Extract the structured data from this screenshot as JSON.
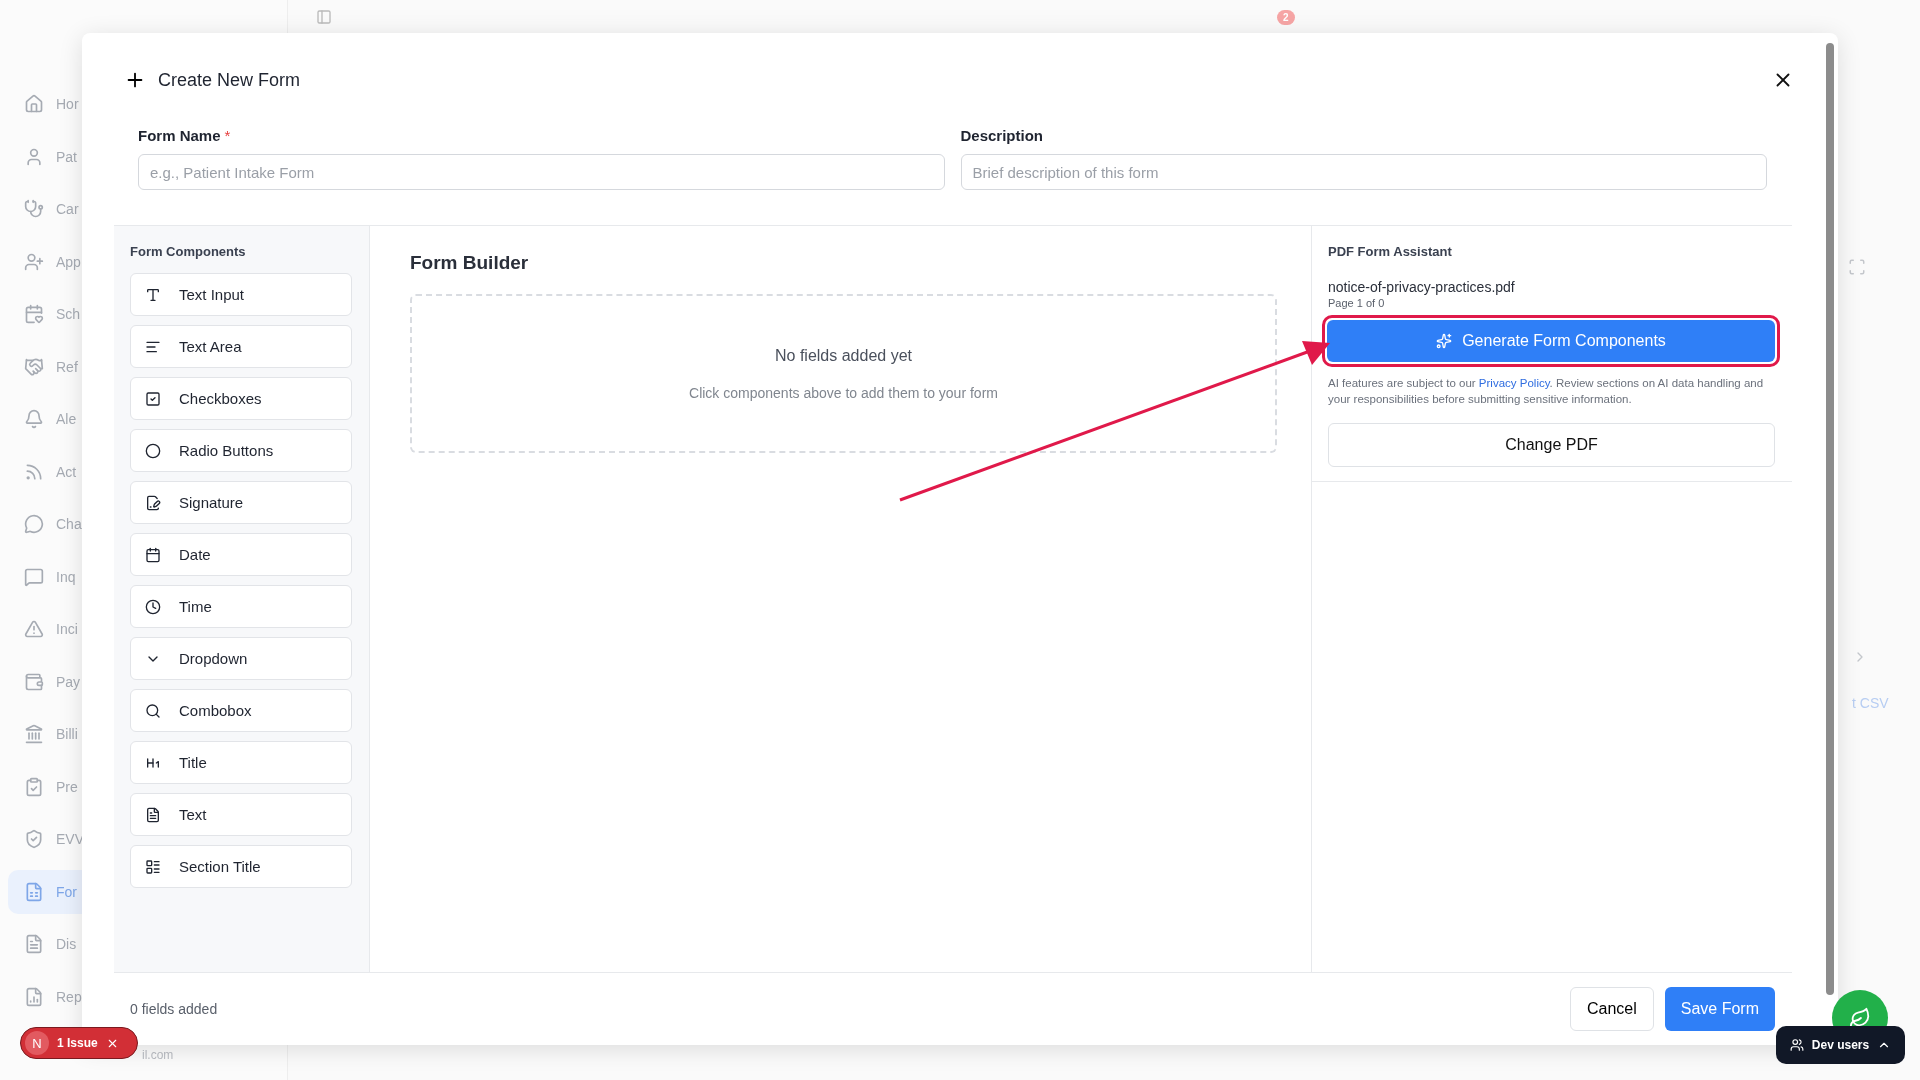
{
  "sidebar": {
    "items": [
      {
        "label": "Hor",
        "selected": false
      },
      {
        "label": "Pat",
        "selected": false
      },
      {
        "label": "Car",
        "selected": false
      },
      {
        "label": "App",
        "selected": false
      },
      {
        "label": "Sch",
        "selected": false
      },
      {
        "label": "Ref",
        "selected": false
      },
      {
        "label": "Ale",
        "selected": false
      },
      {
        "label": "Act",
        "selected": false
      },
      {
        "label": "Cha",
        "selected": false
      },
      {
        "label": "Inq",
        "selected": false
      },
      {
        "label": "Inci",
        "selected": false
      },
      {
        "label": "Pay",
        "selected": false
      },
      {
        "label": "Billi",
        "selected": false
      },
      {
        "label": "Pre",
        "selected": false
      },
      {
        "label": "EVV",
        "selected": false
      },
      {
        "label": "For",
        "selected": true
      },
      {
        "label": "Dis",
        "selected": false
      },
      {
        "label": "Rep",
        "selected": false
      }
    ],
    "account": "il.com"
  },
  "header": {
    "notifications": "2"
  },
  "background": {
    "link": "t CSV"
  },
  "modal": {
    "title": "Create New Form",
    "fields": [
      {
        "label": "Form Name",
        "required_mark": "*",
        "placeholder": "e.g., Patient Intake Form"
      },
      {
        "label": "Description",
        "placeholder": "Brief description of this form"
      }
    ],
    "components": {
      "title": "Form Components",
      "items": [
        "Text Input",
        "Text Area",
        "Checkboxes",
        "Radio Buttons",
        "Signature",
        "Date",
        "Time",
        "Dropdown",
        "Combobox",
        "Title",
        "Text",
        "Section Title"
      ]
    },
    "builder": {
      "title": "Form Builder",
      "empty_title": "No fields added yet",
      "empty_hint": "Click components above to add them to your form"
    },
    "assistant": {
      "title": "PDF Form Assistant",
      "file": "notice-of-privacy-practices.pdf",
      "page": "Page 1 of 0",
      "generate": "Generate Form Components",
      "notice_before": "AI features are subject to our ",
      "notice_link": "Privacy Policy",
      "notice_after": ". Review sections on AI data handling and your responsibilities before submitting sensitive information.",
      "change": "Change PDF"
    },
    "footer": {
      "count": "0 fields added",
      "cancel": "Cancel",
      "save": "Save Form"
    }
  },
  "issues": {
    "avatar": "N",
    "label": "1 Issue"
  },
  "dev_users": {
    "label": "Dev users"
  }
}
